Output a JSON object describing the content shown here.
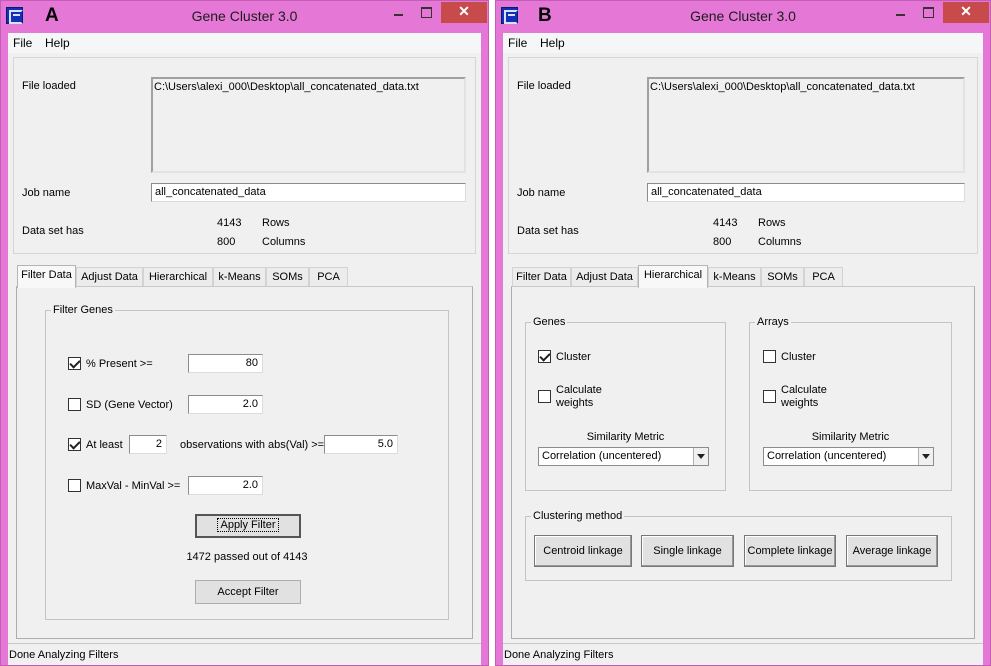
{
  "panel_a": {
    "panel_letter": "A",
    "title": "Gene Cluster 3.0",
    "close_glyph": "✕",
    "menu": {
      "file": "File",
      "help": "Help"
    },
    "file_loaded_label": "File loaded",
    "file_path": "C:\\Users\\alexi_000\\Desktop\\all_concatenated_data.txt",
    "job_name_label": "Job name",
    "job_name_value": "all_concatenated_data",
    "data_set_label": "Data set has",
    "rows_count": "4143",
    "rows_label": "Rows",
    "columns_count": "800",
    "columns_label": "Columns",
    "tabs": [
      "Filter Data",
      "Adjust Data",
      "Hierarchical",
      "k-Means",
      "SOMs",
      "PCA"
    ],
    "active_tab": "Filter Data",
    "filter_genes": {
      "legend": "Filter Genes",
      "percent_present": {
        "label": "% Present >=",
        "value": "80",
        "checked": true
      },
      "sd": {
        "label": "SD (Gene Vector)",
        "value": "2.0",
        "checked": false
      },
      "at_least": {
        "label": "At least",
        "count": "2",
        "label2": "observations with abs(Val) >=",
        "value": "5.0",
        "checked": true
      },
      "maxmin": {
        "label": "MaxVal - MinVal >=",
        "value": "2.0",
        "checked": false
      }
    },
    "apply_filter_label": "Apply Filter",
    "filter_result": "1472 passed out of 4143",
    "accept_filter_label": "Accept Filter",
    "status": "Done Analyzing Filters"
  },
  "panel_b": {
    "panel_letter": "B",
    "title": "Gene Cluster 3.0",
    "close_glyph": "✕",
    "menu": {
      "file": "File",
      "help": "Help"
    },
    "file_loaded_label": "File loaded",
    "file_path": "C:\\Users\\alexi_000\\Desktop\\all_concatenated_data.txt",
    "job_name_label": "Job name",
    "job_name_value": "all_concatenated_data",
    "data_set_label": "Data set has",
    "rows_count": "4143",
    "rows_label": "Rows",
    "columns_count": "800",
    "columns_label": "Columns",
    "tabs": [
      "Filter Data",
      "Adjust Data",
      "Hierarchical",
      "k-Means",
      "SOMs",
      "PCA"
    ],
    "active_tab": "Hierarchical",
    "genes": {
      "legend": "Genes",
      "cluster_label": "Cluster",
      "cluster_checked": true,
      "weights_label_1": "Calculate",
      "weights_label_2": "weights",
      "weights_checked": false,
      "metric_label": "Similarity Metric",
      "metric_value": "Correlation (uncentered)"
    },
    "arrays": {
      "legend": "Arrays",
      "cluster_label": "Cluster",
      "cluster_checked": false,
      "weights_label_1": "Calculate",
      "weights_label_2": "weights",
      "weights_checked": false,
      "metric_label": "Similarity Metric",
      "metric_value": "Correlation (uncentered)"
    },
    "clustering_method": {
      "legend": "Clustering method",
      "buttons": [
        "Centroid linkage",
        "Single linkage",
        "Complete linkage",
        "Average linkage"
      ]
    },
    "status": "Done Analyzing Filters"
  }
}
